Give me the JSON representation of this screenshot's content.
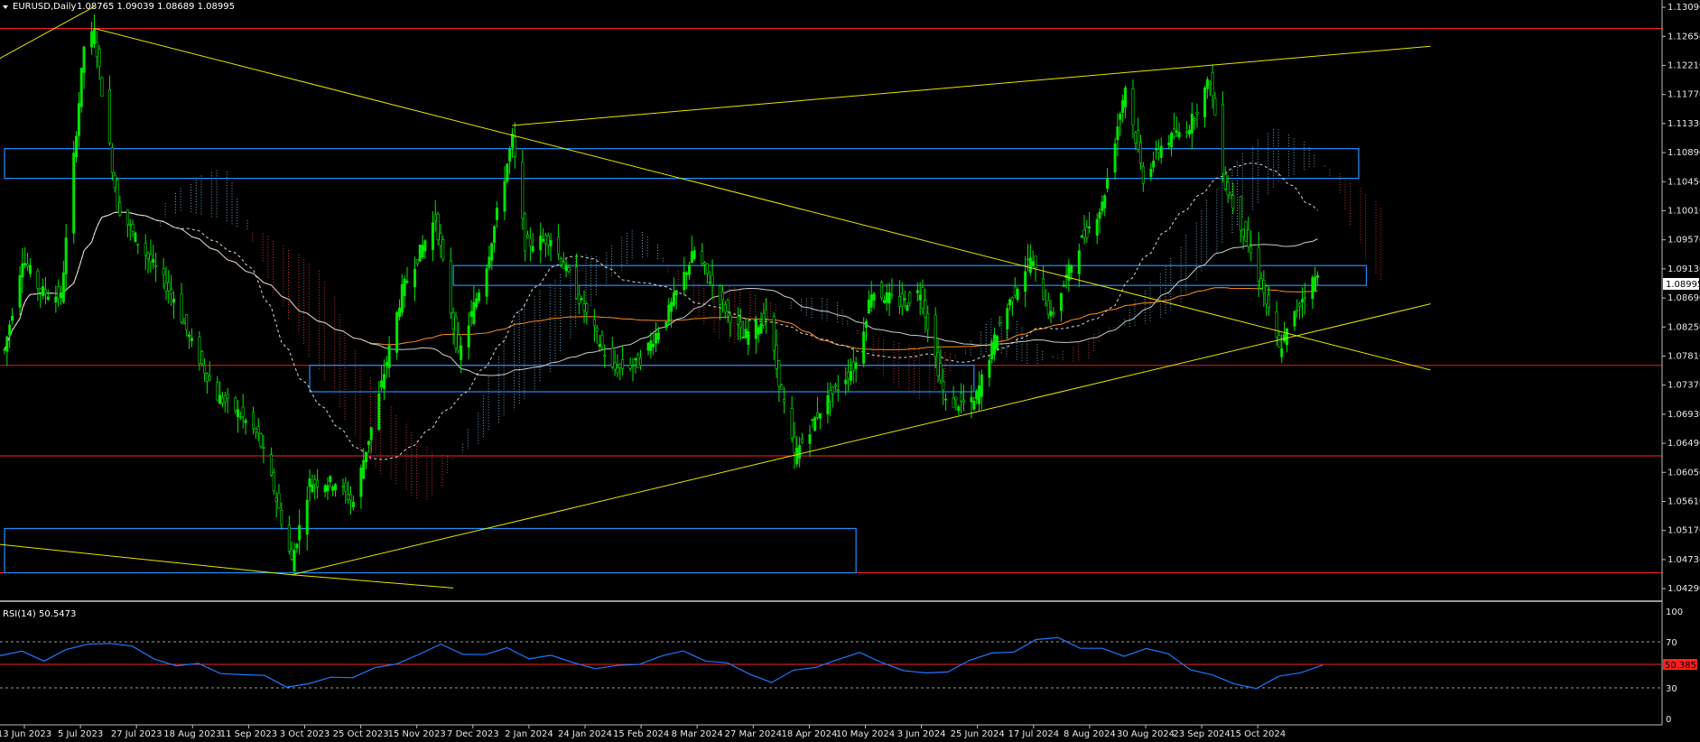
{
  "header": {
    "symbol": "EURUSD,Daily",
    "ohlc": "1.08765 1.09039 1.08689 1.08995"
  },
  "rsi": {
    "label": "RSI(14) 50.5473",
    "levels": [
      "100",
      "70",
      "30",
      "0"
    ],
    "current_label": "50.3858"
  },
  "colors": {
    "background": "#000000",
    "bull_candle": "#00e600",
    "trendline": "#e6e600",
    "zone_box": "#1e90ff",
    "horizontal_level": "#ff2020",
    "cloud_bull": "#87cefa",
    "cloud_bear": "#ff4040",
    "ma_slow": "#ff8c1a",
    "ma_mid": "#ffffff",
    "rsi_line": "#1e78ff",
    "price_tag": "#ffffff",
    "rsi_tag": "#ff2020"
  },
  "chart_data": {
    "type": "candlestick",
    "symbol": "EURUSD",
    "timeframe": "Daily",
    "current_price": "1.08995",
    "ylim": [
      1.041,
      1.132
    ],
    "y_ticks": [
      "1.13090",
      "1.12650",
      "1.12210",
      "1.11770",
      "1.11330",
      "1.10890",
      "1.10450",
      "1.10010",
      "1.09570",
      "1.09130",
      "1.08690",
      "1.08250",
      "1.07810",
      "1.07370",
      "1.06930",
      "1.06490",
      "1.06050",
      "1.05610",
      "1.05170",
      "1.04730",
      "1.04290"
    ],
    "x_ticks": [
      "13 Jun 2023",
      "5 Jul 2023",
      "27 Jul 2023",
      "18 Aug 2023",
      "11 Sep 2023",
      "3 Oct 2023",
      "25 Oct 2023",
      "15 Nov 2023",
      "7 Dec 2023",
      "2 Jan 2024",
      "24 Jan 2024",
      "15 Feb 2024",
      "8 Mar 2024",
      "27 Mar 2024",
      "18 Apr 2024",
      "10 May 2024",
      "3 Jun 2024",
      "25 Jun 2024",
      "17 Jul 2024",
      "8 Aug 2024",
      "30 Aug 2024",
      "23 Sep 2024",
      "15 Oct 2024"
    ],
    "close_path": [
      [
        "2023-06-13",
        1.079
      ],
      [
        "2023-06-20",
        1.093
      ],
      [
        "2023-06-27",
        1.088
      ],
      [
        "2023-07-05",
        1.087
      ],
      [
        "2023-07-14",
        1.125
      ],
      [
        "2023-07-18",
        1.127
      ],
      [
        "2023-07-27",
        1.101
      ],
      [
        "2023-08-03",
        1.096
      ],
      [
        "2023-08-18",
        1.087
      ],
      [
        "2023-08-25",
        1.08
      ],
      [
        "2023-09-04",
        1.072
      ],
      [
        "2023-09-11",
        1.07
      ],
      [
        "2023-09-20",
        1.066
      ],
      [
        "2023-09-26",
        1.058
      ],
      [
        "2023-10-03",
        1.047
      ],
      [
        "2023-10-10",
        1.059
      ],
      [
        "2023-10-20",
        1.059
      ],
      [
        "2023-10-27",
        1.056
      ],
      [
        "2023-11-06",
        1.072
      ],
      [
        "2023-11-15",
        1.088
      ],
      [
        "2023-11-28",
        1.099
      ],
      [
        "2023-12-07",
        1.078
      ],
      [
        "2023-12-18",
        1.092
      ],
      [
        "2023-12-28",
        1.111
      ],
      [
        "2024-01-02",
        1.095
      ],
      [
        "2024-01-12",
        1.096
      ],
      [
        "2024-01-24",
        1.086
      ],
      [
        "2024-02-05",
        1.076
      ],
      [
        "2024-02-15",
        1.077
      ],
      [
        "2024-02-26",
        1.084
      ],
      [
        "2024-03-08",
        1.094
      ],
      [
        "2024-03-19",
        1.086
      ],
      [
        "2024-03-27",
        1.081
      ],
      [
        "2024-04-05",
        1.084
      ],
      [
        "2024-04-16",
        1.063
      ],
      [
        "2024-04-26",
        1.07
      ],
      [
        "2024-05-10",
        1.077
      ],
      [
        "2024-05-16",
        1.088
      ],
      [
        "2024-05-28",
        1.086
      ],
      [
        "2024-06-04",
        1.088
      ],
      [
        "2024-06-14",
        1.071
      ],
      [
        "2024-06-25",
        1.071
      ],
      [
        "2024-07-05",
        1.083
      ],
      [
        "2024-07-17",
        1.093
      ],
      [
        "2024-07-25",
        1.084
      ],
      [
        "2024-08-05",
        1.095
      ],
      [
        "2024-08-14",
        1.101
      ],
      [
        "2024-08-23",
        1.119
      ],
      [
        "2024-08-30",
        1.105
      ],
      [
        "2024-09-06",
        1.11
      ],
      [
        "2024-09-17",
        1.113
      ],
      [
        "2024-09-25",
        1.12
      ],
      [
        "2024-10-01",
        1.104
      ],
      [
        "2024-10-08",
        1.097
      ],
      [
        "2024-10-15",
        1.089
      ],
      [
        "2024-10-22",
        1.079
      ],
      [
        "2024-10-31",
        1.087
      ],
      [
        "2024-11-05",
        1.09
      ],
      [
        "2024-11-06",
        1.08995
      ]
    ],
    "horizontal_levels": [
      1.1277,
      1.0767,
      1.063,
      1.0453
    ],
    "zones": [
      {
        "from": "2023-06-13",
        "to": "2024-11-22",
        "high": 1.1095,
        "low": 1.105
      },
      {
        "from": "2023-12-05",
        "to": "2024-11-25",
        "high": 1.0918,
        "low": 1.0888
      },
      {
        "from": "2023-10-10",
        "to": "2024-06-25",
        "high": 1.0767,
        "low": 1.0727
      },
      {
        "from": "2023-06-13",
        "to": "2024-05-10",
        "high": 1.052,
        "low": 1.0453
      }
    ],
    "rsi_values": [
      58,
      60,
      56,
      62,
      68,
      72,
      64,
      56,
      50,
      48,
      44,
      40,
      38,
      32,
      30,
      38,
      40,
      44,
      52,
      60,
      66,
      62,
      58,
      64,
      58,
      56,
      52,
      48,
      46,
      52,
      58,
      60,
      56,
      50,
      40,
      36,
      42,
      48,
      56,
      58,
      54,
      44,
      40,
      46,
      52,
      60,
      64,
      70,
      76,
      66,
      62,
      60,
      64,
      58,
      48,
      38,
      32,
      30,
      36,
      44,
      50
    ],
    "rsi_current": 50.5473,
    "rsi_levels": [
      70,
      30
    ]
  }
}
